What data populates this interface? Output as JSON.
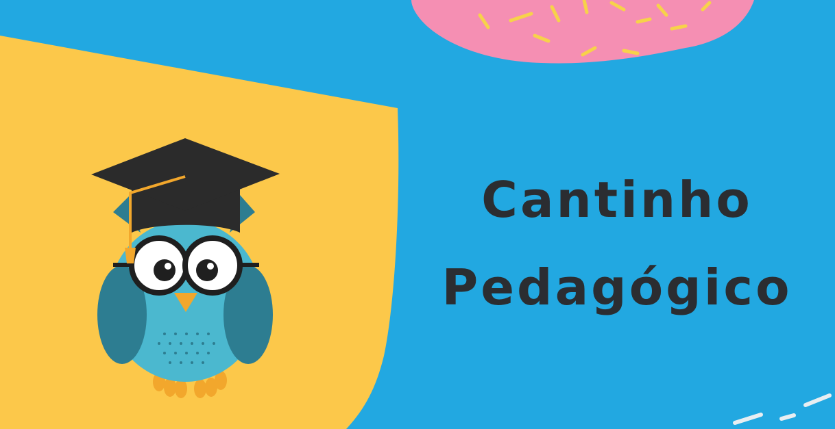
{
  "title": {
    "line1": "Cantinho",
    "line2": "Pedagógico"
  },
  "colors": {
    "background": "#22a8e1",
    "yellow_panel": "#fcc84a",
    "pink_blob": "#f58fb3",
    "sprinkles": "#f7d24a",
    "text": "#2b2d31",
    "owl_body": "#4bb8cf",
    "owl_wing": "#2d7d91",
    "cap": "#2b2b2b"
  },
  "illustration": {
    "subject": "owl-with-graduation-cap-and-glasses"
  }
}
